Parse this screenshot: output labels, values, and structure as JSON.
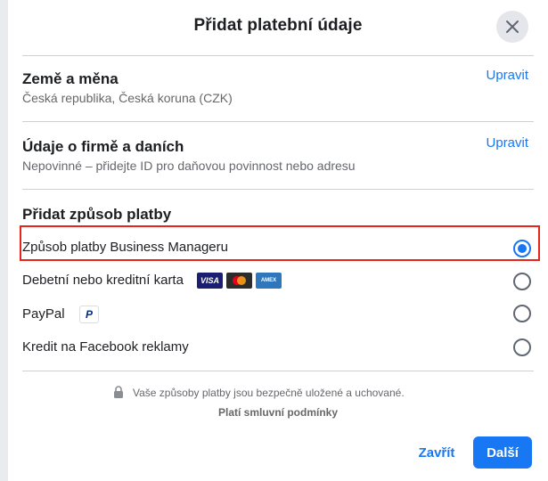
{
  "dialog": {
    "title": "Přidat platební údaje",
    "close_icon": "close-icon"
  },
  "country_section": {
    "title": "Země a měna",
    "subtitle": "Česká republika, Česká koruna (CZK)",
    "edit_label": "Upravit"
  },
  "business_section": {
    "title": "Údaje o firmě a daních",
    "subtitle": "Nepovinné – přidejte ID pro daňovou povinnost nebo adresu",
    "edit_label": "Upravit"
  },
  "payment_section": {
    "title": "Přidat způsob platby",
    "options": [
      {
        "label": "Způsob platby Business Manageru",
        "selected": true
      },
      {
        "label": "Debetní nebo kreditní karta",
        "selected": false,
        "card_logos": [
          "VISA",
          "mastercard-icon",
          "AMEX"
        ]
      },
      {
        "label": "PayPal",
        "selected": false,
        "logo": "P"
      },
      {
        "label": "Kredit na Facebook reklamy",
        "selected": false
      }
    ]
  },
  "footer": {
    "secure_text": "Vaše způsoby platby jsou bezpečně uložené a uchované.",
    "terms_label": "Platí smluvní podmínky",
    "close_label": "Zavřít",
    "next_label": "Další"
  },
  "colors": {
    "accent": "#1877f2",
    "highlight_border": "#e8241b",
    "muted_text": "#65676b",
    "divider": "#ced0d4"
  }
}
